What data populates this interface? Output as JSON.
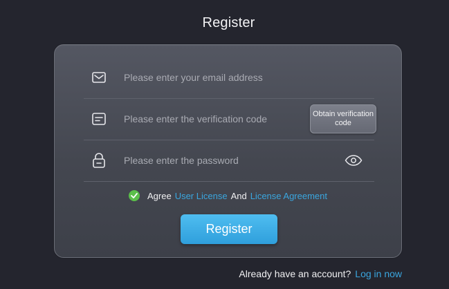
{
  "page": {
    "title": "Register"
  },
  "form": {
    "email": {
      "value": "",
      "placeholder": "Please enter your email address",
      "icon": "envelope-icon"
    },
    "verification": {
      "value": "",
      "placeholder": "Please enter the verification code",
      "icon": "message-icon",
      "obtain_button_label": "Obtain verification code"
    },
    "password": {
      "value": "",
      "placeholder": "Please enter the password",
      "icon": "lock-icon",
      "toggle_icon": "eye-icon"
    },
    "agreement": {
      "checked": true,
      "agree_text": "Agree",
      "user_license_link": "User License",
      "and_text": "And",
      "license_agreement_link": "License Agreement"
    },
    "register_button_label": "Register"
  },
  "footer": {
    "prompt": "Already have an account?",
    "login_link": "Log in now"
  },
  "colors": {
    "background": "#24252e",
    "card": "#4a4d57",
    "accent": "#3aa6df",
    "check": "#5bbf4a"
  }
}
